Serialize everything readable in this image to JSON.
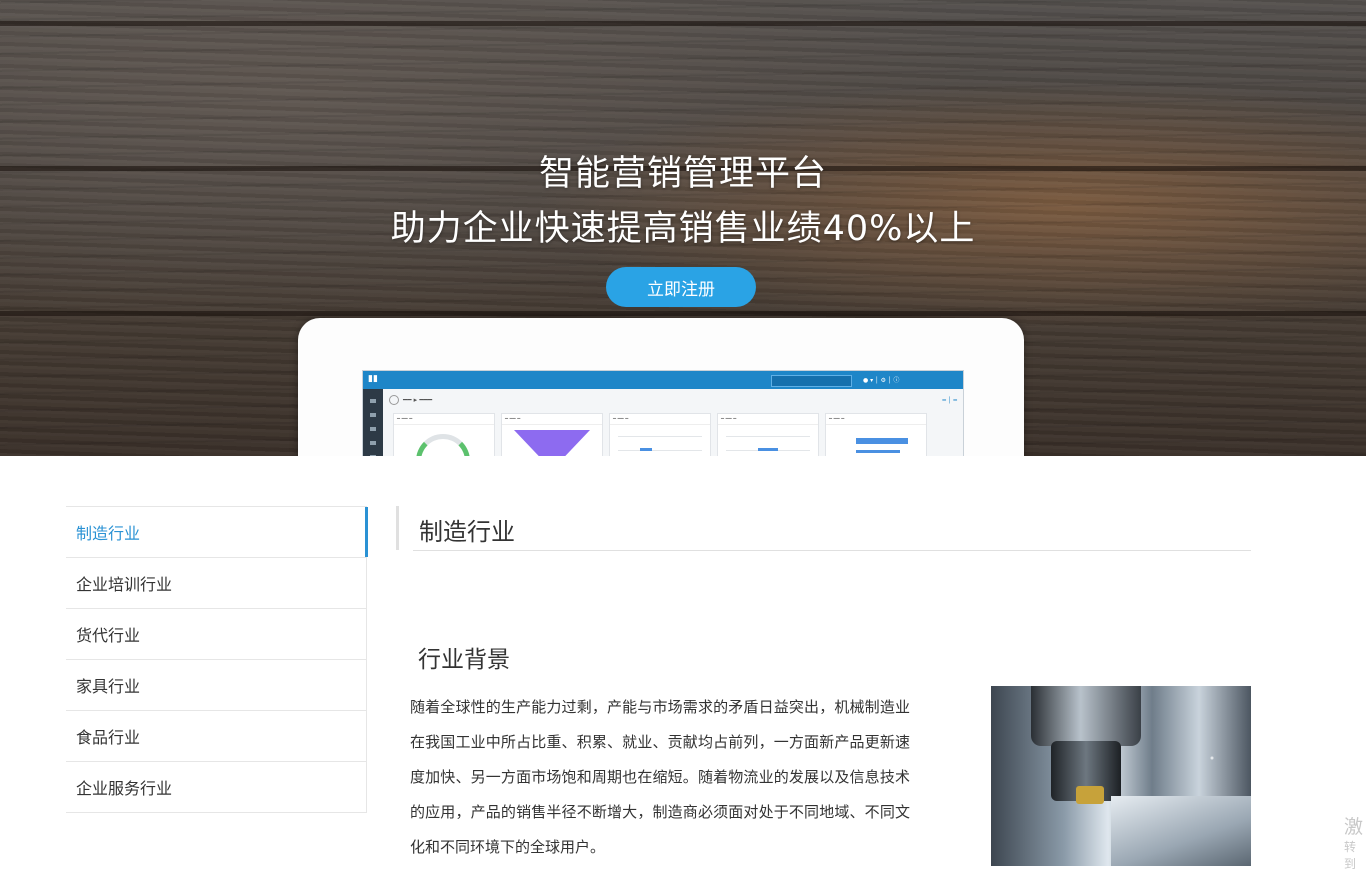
{
  "hero": {
    "title_line1": "智能营销管理平台",
    "title_line2": "助力企业快速提高销售业绩40%以上",
    "register_label": "立即注册"
  },
  "sidebar": {
    "items": [
      {
        "label": "制造行业",
        "active": true
      },
      {
        "label": "企业培训行业",
        "active": false
      },
      {
        "label": "货代行业",
        "active": false
      },
      {
        "label": "家具行业",
        "active": false
      },
      {
        "label": "食品行业",
        "active": false
      },
      {
        "label": "企业服务行业",
        "active": false
      }
    ]
  },
  "main": {
    "title": "制造行业",
    "section_title": "行业背景",
    "body": "随着全球性的生产能力过剩，产能与市场需求的矛盾日益突出，机械制造业在我国工业中所占比重、积累、就业、贡献均占前列，一方面新产品更新速度加快、另一方面市场饱和周期也在缩短。随着物流业的发展以及信息技术的应用，产品的销售半径不断增大，制造商必须面对处于不同地域、不同文化和不同环境下的全球用户。"
  },
  "watermark": {
    "line1": "激",
    "line2": "转到"
  },
  "colors": {
    "accent": "#2a92d4",
    "button": "#2aa3e5"
  }
}
